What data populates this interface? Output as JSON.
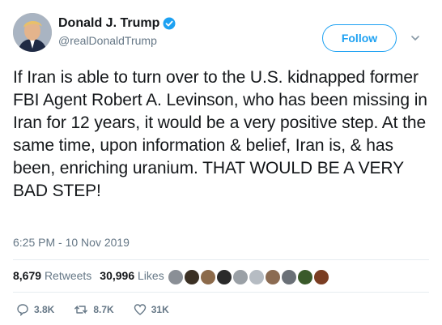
{
  "author": {
    "display_name": "Donald J. Trump",
    "handle": "@realDonaldTrump",
    "verified_icon": "verified-badge-icon",
    "avatar_icon": "avatar"
  },
  "follow_button": {
    "label": "Follow"
  },
  "tweet": {
    "text": "If Iran is able to turn over to the U.S. kidnapped former FBI Agent Robert A. Levinson, who has been missing in Iran for 12 years, it would be a very positive step. At the same time, upon information & belief, Iran is, & has been, enriching uranium. THAT WOULD BE A VERY BAD STEP!",
    "timestamp": "6:25 PM - 10 Nov 2019"
  },
  "stats": {
    "retweets_count": "8,679",
    "retweets_label": "Retweets",
    "likes_count": "30,996",
    "likes_label": "Likes"
  },
  "liker_faces": [
    "#8a8f96",
    "#3b3024",
    "#8c6a4a",
    "#2a2a2a",
    "#9aa0a6",
    "#b6bcc3",
    "#8b6b52",
    "#6a7077",
    "#3a5a2a",
    "#7a3d22"
  ],
  "actions": {
    "reply_count": "3.8K",
    "retweet_count": "8.7K",
    "like_count": "31K"
  },
  "colors": {
    "accent": "#1da1f2",
    "muted": "#657786",
    "text": "#14171a"
  }
}
